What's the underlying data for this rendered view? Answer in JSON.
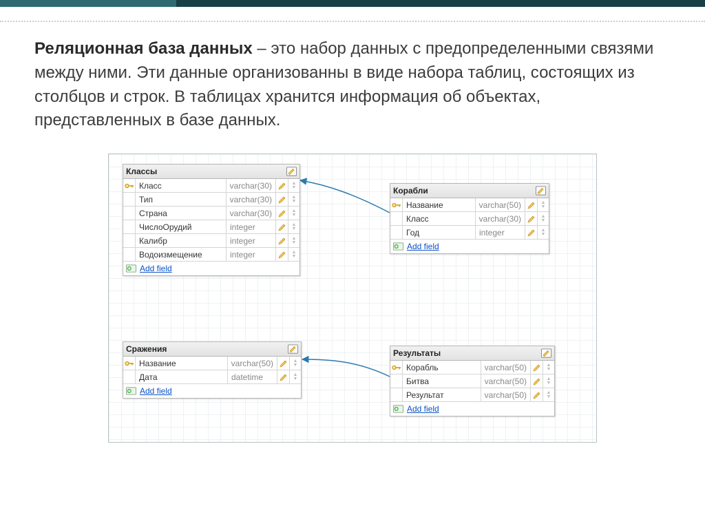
{
  "text": {
    "bold": "Реляционная база данных",
    "rest": " – это набор данных с предопределенными связями между ними. Эти данные организованны в виде набора таблиц, состоящих из столбцов и строк. В таблицах хранится информация об объектах, представленных в базе данных."
  },
  "add_field_label": "Add field",
  "tables": {
    "classes": {
      "title": "Классы",
      "fields": [
        {
          "name": "Класс",
          "type": "varchar(30)",
          "pk": true
        },
        {
          "name": "Тип",
          "type": "varchar(30)",
          "pk": false
        },
        {
          "name": "Страна",
          "type": "varchar(30)",
          "pk": false
        },
        {
          "name": "ЧислоОрудий",
          "type": "integer",
          "pk": false
        },
        {
          "name": "Калибр",
          "type": "integer",
          "pk": false
        },
        {
          "name": "Водоизмещение",
          "type": "integer",
          "pk": false
        }
      ]
    },
    "ships": {
      "title": "Корабли",
      "fields": [
        {
          "name": "Название",
          "type": "varchar(50)",
          "pk": true
        },
        {
          "name": "Класс",
          "type": "varchar(30)",
          "pk": false
        },
        {
          "name": "Год",
          "type": "integer",
          "pk": false
        }
      ]
    },
    "battles": {
      "title": "Сражения",
      "fields": [
        {
          "name": "Название",
          "type": "varchar(50)",
          "pk": true
        },
        {
          "name": "Дата",
          "type": "datetime",
          "pk": false
        }
      ]
    },
    "results": {
      "title": "Результаты",
      "fields": [
        {
          "name": "Корабль",
          "type": "varchar(50)",
          "pk": true
        },
        {
          "name": "Битва",
          "type": "varchar(50)",
          "pk": false
        },
        {
          "name": "Результат",
          "type": "varchar(50)",
          "pk": false
        }
      ]
    }
  }
}
